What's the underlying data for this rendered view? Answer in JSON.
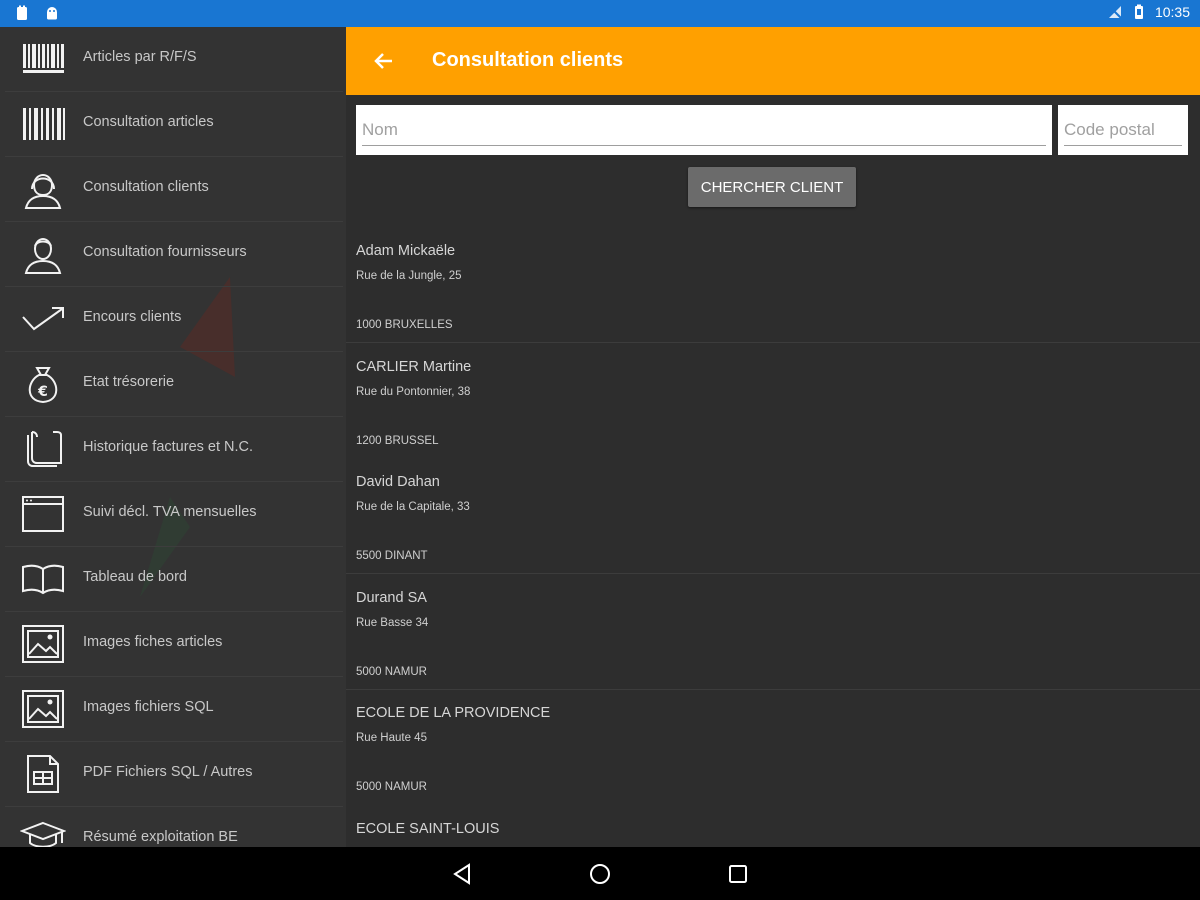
{
  "status_bar": {
    "time": "10:35",
    "left_icons": [
      "notification-icon",
      "android-icon"
    ],
    "right_icons": [
      "no-sim-icon",
      "battery-icon"
    ],
    "color": "#1976d2"
  },
  "drawer": {
    "items": [
      {
        "label": "Articles par R/F/S",
        "icon": "barcode-small-icon"
      },
      {
        "label": "Consultation articles",
        "icon": "barcode-icon"
      },
      {
        "label": "Consultation clients",
        "icon": "female-user-icon"
      },
      {
        "label": "Consultation fournisseurs",
        "icon": "male-user-icon"
      },
      {
        "label": "Encours clients",
        "icon": "trend-arrow-icon"
      },
      {
        "label": "Etat trésorerie",
        "icon": "money-bag-icon"
      },
      {
        "label": "Historique factures et N.C.",
        "icon": "stacked-pages-icon"
      },
      {
        "label": "Suivi décl. TVA mensuelles",
        "icon": "window-icon"
      },
      {
        "label": "Tableau de bord",
        "icon": "open-book-icon"
      },
      {
        "label": "Images fiches articles",
        "icon": "image-frame-icon"
      },
      {
        "label": "Images fichiers SQL",
        "icon": "image-file-icon"
      },
      {
        "label": "PDF Fichiers SQL / Autres",
        "icon": "pdf-document-icon"
      },
      {
        "label": "Résumé exploitation BE",
        "icon": "graduation-cap-icon"
      }
    ]
  },
  "appbar": {
    "title": "Consultation clients",
    "color": "#ffa000"
  },
  "search": {
    "name_placeholder": "Nom",
    "name_value": "",
    "postal_placeholder": "Code postal",
    "postal_value": "",
    "button_label": "CHERCHER CLIENT"
  },
  "clients": [
    {
      "name": "Adam Mickaële",
      "street": "Rue de la Jungle, 25",
      "city": "1000 BRUXELLES"
    },
    {
      "name": "CARLIER Martine",
      "street": "Rue du Pontonnier, 38",
      "city": "1200 BRUSSEL"
    },
    {
      "name": "David Dahan",
      "street": "Rue de la Capitale, 33",
      "city": "5500 DINANT"
    },
    {
      "name": "Durand SA",
      "street": "Rue Basse 34",
      "city": "5000 NAMUR"
    },
    {
      "name": "ECOLE DE LA PROVIDENCE",
      "street": "Rue Haute 45",
      "city": "5000 NAMUR"
    },
    {
      "name": "ECOLE SAINT-LOUIS",
      "street": "",
      "city": ""
    }
  ],
  "navbar": {
    "buttons": [
      "back-triangle-icon",
      "home-circle-icon",
      "recents-square-icon"
    ]
  }
}
